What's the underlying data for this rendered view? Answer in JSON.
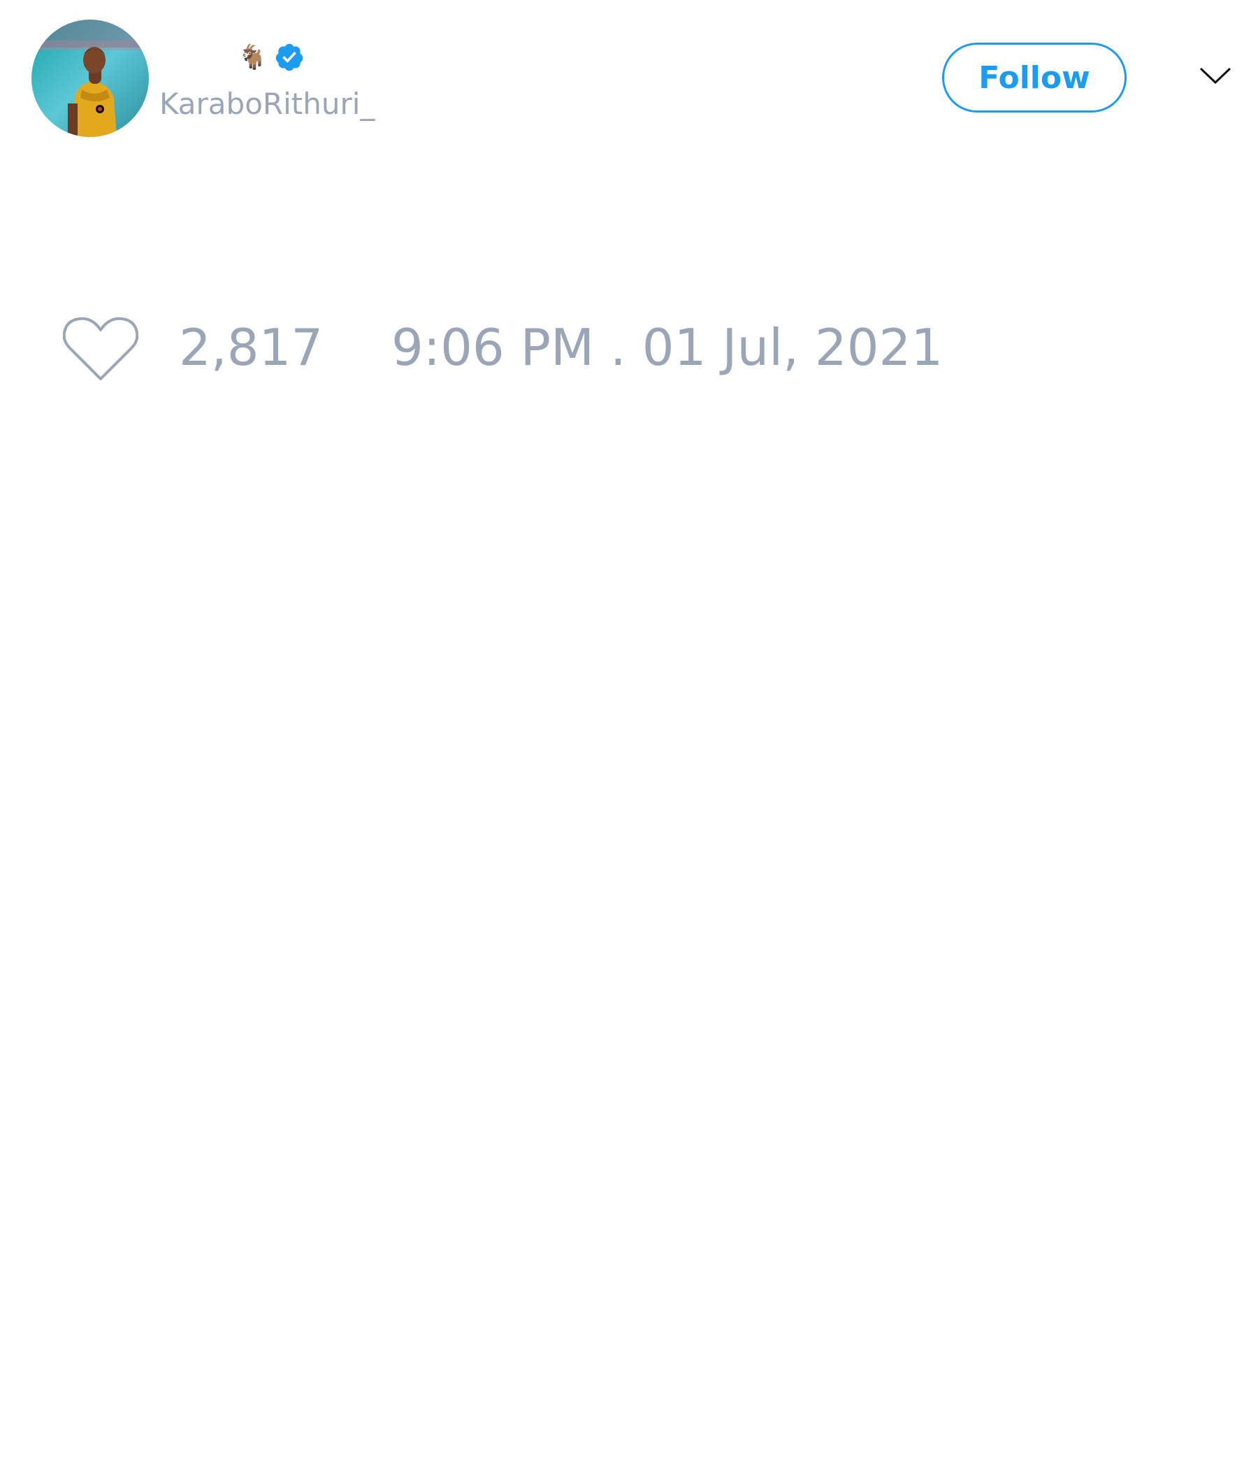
{
  "user": {
    "display_name_emoji": "🐐",
    "handle": "KaraboRithuri_",
    "verified": true,
    "avatar_icon": "profile-photo-avatar"
  },
  "actions": {
    "follow_label": "Follow",
    "menu_icon": "chevron-down-icon"
  },
  "stats": {
    "likes": "2,817",
    "like_icon": "heart-outline-icon",
    "timestamp": "9:06 PM . 01 Jul, 2021"
  },
  "colors": {
    "accent": "#1d9bf0",
    "muted_text": "#9aa6b8",
    "background": "#ffffff"
  }
}
